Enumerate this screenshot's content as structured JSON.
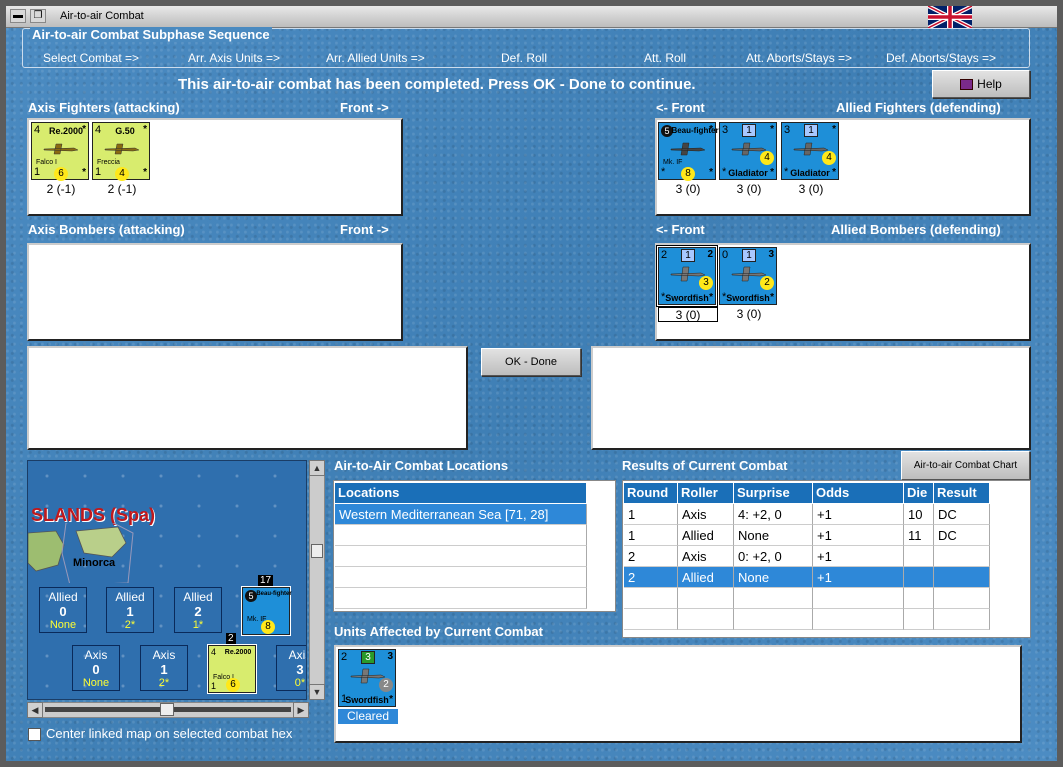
{
  "window": {
    "title": "Air-to-air Combat"
  },
  "sequence": {
    "title": "Air-to-air Combat Subphase Sequence",
    "steps": [
      "Select Combat =>",
      "Arr. Axis Units =>",
      "Arr. Allied Units =>",
      "Def. Roll",
      "Att. Roll",
      "Att. Aborts/Stays =>",
      "Def. Aborts/Stays =>"
    ]
  },
  "banner": "This air-to-air combat has been completed.  Press OK - Done to continue.",
  "help_button": "Help",
  "ok_button": "OK - Done",
  "chart_button": "Air-to-air Combat Chart",
  "sections": {
    "axis_fighters": "Axis Fighters (attacking)",
    "axis_fighters_front": "Front ->",
    "allied_fighters_front": "<- Front",
    "allied_fighters": "Allied Fighters (defending)",
    "axis_bombers": "Axis Bombers (attacking)",
    "axis_bombers_front": "Front ->",
    "allied_bombers_front": "<- Front",
    "allied_bombers": "Allied Bombers (defending)",
    "locations_title": "Air-to-Air Combat Locations",
    "results_title": "Results of Current Combat",
    "affected_title": "Units Affected by Current Combat"
  },
  "axis_fighters": [
    {
      "name": "Re.2000",
      "sub": "Falco I",
      "tl": "4",
      "bl": "1",
      "circ": "6",
      "strength": "2 (-1)"
    },
    {
      "name": "G.50",
      "sub": "Freccia",
      "tl": "4",
      "bl": "1",
      "circ": "4",
      "strength": "2 (-1)"
    }
  ],
  "allied_fighters": [
    {
      "name": "Beau-fighter",
      "sub": "Mk. IF",
      "tl": "5",
      "circ": "8",
      "strength": "3 (0)"
    },
    {
      "name": "Gladiator",
      "sq": "1",
      "tl": "3",
      "circ": "4",
      "strength": "3 (0)"
    },
    {
      "name": "Gladiator",
      "sq": "1",
      "tl": "3",
      "circ": "4",
      "strength": "3 (0)"
    }
  ],
  "allied_bombers": [
    {
      "name": "Swordfish",
      "sq": "1",
      "tl": "2",
      "tr": "2",
      "circ": "3",
      "strength": "3 (0)"
    },
    {
      "name": "Swordfish",
      "sq": "1",
      "tl": "0",
      "tr": "3",
      "circ": "2",
      "strength": "3 (0)"
    }
  ],
  "locations": {
    "header": "Locations",
    "rows": [
      "Western Mediterranean Sea [71, 28]"
    ]
  },
  "results": {
    "headers": [
      "Round",
      "Roller",
      "Surprise",
      "Odds",
      "Die",
      "Result"
    ],
    "rows": [
      [
        "1",
        "Axis",
        "4: +2, 0",
        "+1",
        "10",
        "DC"
      ],
      [
        "1",
        "Allied",
        "None",
        "+1",
        "11",
        "DC"
      ],
      [
        "2",
        "Axis",
        "0: +2, 0",
        "+1",
        "",
        ""
      ],
      [
        "2",
        "Allied",
        "None",
        "+1",
        "",
        ""
      ]
    ]
  },
  "affected": {
    "unit": {
      "name": "Swordfish",
      "sq": "3",
      "tl": "2",
      "tr": "3",
      "bl": "1",
      "circ": "2",
      "status": "Cleared"
    }
  },
  "map": {
    "title": "SLANDS (Spa)",
    "island": "Minorca",
    "allied_boxes": [
      {
        "t": "Allied",
        "v": "0",
        "f": "None"
      },
      {
        "t": "Allied",
        "v": "1",
        "f": "2*"
      },
      {
        "t": "Allied",
        "v": "2",
        "f": "1*"
      }
    ],
    "axis_boxes": [
      {
        "t": "Axis",
        "v": "0",
        "f": "None"
      },
      {
        "t": "Axis",
        "v": "1",
        "f": "2*"
      },
      {
        "t": "Axis",
        "v": "3",
        "f": "0*"
      }
    ],
    "stack_allied": "17",
    "stack_axis": "2",
    "map_counter_allied": {
      "name": "Beau-fighter",
      "sub": "Mk. IF",
      "tl": "5",
      "circ": "8"
    },
    "map_counter_axis": {
      "name": "Re.2000",
      "sub": "Falco I",
      "tl": "4",
      "bl": "1",
      "circ": "6"
    }
  },
  "center_checkbox": "Center linked map on selected combat hex"
}
